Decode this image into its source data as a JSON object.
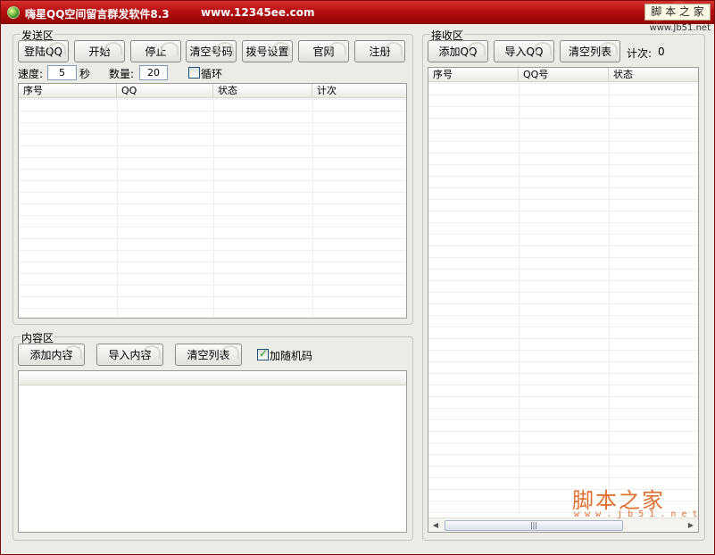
{
  "window": {
    "title": "嗨星QQ空间留言群发软件8.3",
    "site": "www.12345ee.com",
    "badge": "脚 本 之 家",
    "badge_url": "www.Jb51.net"
  },
  "send_area": {
    "legend": "发送区",
    "buttons": [
      "登陆QQ",
      "开始",
      "停止",
      "清空号码",
      "拨号设置",
      "官网",
      "注册"
    ],
    "speed_label": "速度:",
    "speed_value": "5",
    "speed_unit": "秒",
    "count_label": "数量:",
    "count_value": "20",
    "loop_label": "循环",
    "loop_checked": false,
    "columns": [
      "序号",
      "QQ",
      "状态",
      "计次"
    ]
  },
  "content_area": {
    "legend": "内容区",
    "add_label": "添加内容",
    "import_label": "导入内容",
    "clear_label": "清空列表",
    "random_label": "加随机码",
    "random_checked": true
  },
  "receive_area": {
    "legend": "接收区",
    "add_label": "添加QQ",
    "import_label": "导入QQ",
    "clear_label": "清空列表",
    "count_label": "计次:",
    "count_value": "0",
    "columns": [
      "序号",
      "QQ号",
      "状态"
    ]
  },
  "watermark": {
    "text": "脚本之家",
    "url": "w w w . j b 5 1 . n e t"
  },
  "colors": {
    "titlebar": "#b40f10",
    "window_bg": "#ecebe6",
    "watermark": "#e07030"
  }
}
